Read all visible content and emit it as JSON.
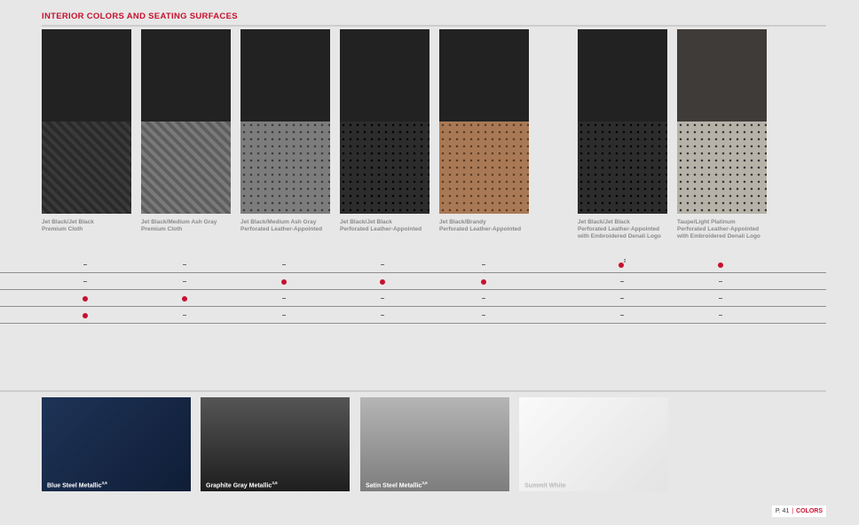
{
  "section_title": "INTERIOR COLORS AND SEATING SURFACES",
  "swatches": [
    {
      "caption": [
        "Jet Black/Jet Black",
        "Premium Cloth"
      ]
    },
    {
      "caption": [
        "Jet Black/Medium Ash Gray",
        "Premium Cloth"
      ]
    },
    {
      "caption": [
        "Jet Black/Medium Ash Gray",
        "Perforated Leather-Appointed"
      ]
    },
    {
      "caption": [
        "Jet Black/Jet Black",
        "Perforated Leather-Appointed"
      ]
    },
    {
      "caption": [
        "Jet Black/Brandy",
        "Perforated Leather-Appointed"
      ]
    },
    {
      "caption": [
        "Jet Black/Jet Black",
        "Perforated Leather-Appointed",
        "with Embroidered Denali Logo"
      ]
    },
    {
      "caption": [
        "Taupe/Light Platinum",
        "Perforated Leather-Appointed",
        "with Embroidered Denali Logo"
      ]
    }
  ],
  "availability": [
    [
      "–",
      "–",
      "–",
      "–",
      "–",
      "●2",
      "●"
    ],
    [
      "–",
      "–",
      "●",
      "●",
      "●",
      "–",
      "–"
    ],
    [
      "●",
      "●",
      "–",
      "–",
      "–",
      "–",
      "–"
    ],
    [
      "●",
      "–",
      "–",
      "–",
      "–",
      "–",
      "–"
    ]
  ],
  "paints": [
    {
      "name": "Blue Steel Metallic",
      "sup": "3,6",
      "color": "#1a2c4e"
    },
    {
      "name": "Graphite Gray Metallic",
      "sup": "3,6",
      "color": "#3a3a3a"
    },
    {
      "name": "Satin Steel Metallic",
      "sup": "3,6",
      "color": "#9a9a9a"
    },
    {
      "name": "Summit White",
      "sup": "",
      "color": "#f2f2f2"
    }
  ],
  "footer": {
    "page": "P. 41",
    "divider": "|",
    "section": "COLORS"
  },
  "accent_color": "#c8102e"
}
